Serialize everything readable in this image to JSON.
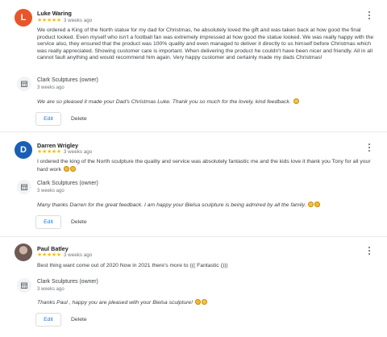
{
  "reviews": [
    {
      "avatar_letter": "L",
      "avatar_color": "#e8552a",
      "name": "Luke Waring",
      "stars": "★★★★★",
      "time": "3 weeks ago",
      "text": "We ordered a King of the North statue for my dad for Christmas, he absolutely loved the gift and was taken back at how good the final product looked. Even myself who isn't a football fan was extremely impressed at how good the statue looked. We was really happy with the service also, they ensured that the product was 100% quality and even managed to deliver it directly to us himself before Christmas which was really appreciated. Showing customer care is important. When delivering the product he couldn't have been nicer and friendly. All in all cannot fault anything and would recommend him again. Very happy customer and certainly made my dads Christmas!",
      "owner_name": "Clark Sculptures (owner)",
      "owner_time": "3 weeks ago",
      "reply": "We are so pleased it made your Dad's Christmas Luke. Thank you so much for the lovely, kind feedback.",
      "edit_label": "Edit",
      "delete_label": "Delete"
    },
    {
      "avatar_letter": "D",
      "avatar_color": "#1a5fb4",
      "name": "Darren Wrigley",
      "stars": "★★★★★",
      "time": "3 weeks ago",
      "text": "I ordered the king of the North sculpture the quality and service was absolutely fantastic me and the kids love it thank you Tony for all your hard work",
      "owner_name": "Clark Sculptures (owner)",
      "owner_time": "3 weeks ago",
      "reply": "Many thanks Darren for the great feedback. I am happy your Bielsa sculpture is being admired by all the family.",
      "edit_label": "Edit",
      "delete_label": "Delete"
    },
    {
      "name": "Paul Batley",
      "stars": "★★★★★",
      "time": "3 weeks ago",
      "text": "Best thing want come out of 2020 Now in 2021 there's more to ((( Fantastic ()))",
      "owner_name": "Clark Sculptures (owner)",
      "owner_time": "3 weeks ago",
      "reply": "Thanks Paul , happy you are pleased with your Bielsa sculpture!",
      "edit_label": "Edit",
      "delete_label": "Delete"
    }
  ],
  "colors": {
    "star": "#fbbc04",
    "link_blue": "#1a73e8"
  },
  "icons": {
    "more": "more-vert-icon",
    "owner": "store-icon",
    "emoji": "emoji-icon"
  }
}
